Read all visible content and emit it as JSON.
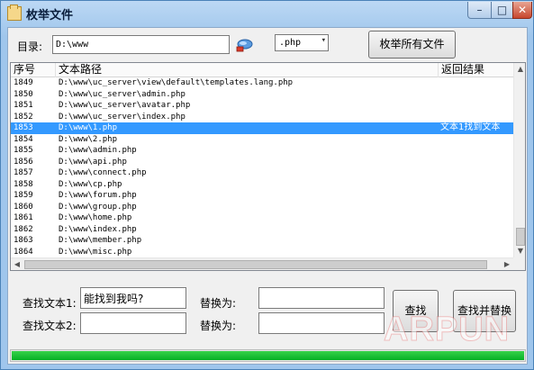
{
  "window": {
    "title": "枚举文件",
    "minimize_glyph": "–",
    "maximize_glyph": "□",
    "close_glyph": "✕",
    "icon": "folder-icon"
  },
  "toolbar": {
    "dir_label": "目录:",
    "dir_value": "D:\\www",
    "browse_icon": "browse-folder-icon",
    "ext_value": ".php",
    "enum_button": "枚举所有文件"
  },
  "list": {
    "columns": [
      "序号",
      "文本路径",
      "返回结果"
    ],
    "rows": [
      {
        "no": "1849",
        "path": "D:\\www\\uc_server\\view\\default\\templates.lang.php",
        "result": ""
      },
      {
        "no": "1850",
        "path": "D:\\www\\uc_server\\admin.php",
        "result": ""
      },
      {
        "no": "1851",
        "path": "D:\\www\\uc_server\\avatar.php",
        "result": ""
      },
      {
        "no": "1852",
        "path": "D:\\www\\uc_server\\index.php",
        "result": ""
      },
      {
        "no": "1853",
        "path": "D:\\www\\1.php",
        "result": "文本1找到文本"
      },
      {
        "no": "1854",
        "path": "D:\\www\\2.php",
        "result": ""
      },
      {
        "no": "1855",
        "path": "D:\\www\\admin.php",
        "result": ""
      },
      {
        "no": "1856",
        "path": "D:\\www\\api.php",
        "result": ""
      },
      {
        "no": "1857",
        "path": "D:\\www\\connect.php",
        "result": ""
      },
      {
        "no": "1858",
        "path": "D:\\www\\cp.php",
        "result": ""
      },
      {
        "no": "1859",
        "path": "D:\\www\\forum.php",
        "result": ""
      },
      {
        "no": "1860",
        "path": "D:\\www\\group.php",
        "result": ""
      },
      {
        "no": "1861",
        "path": "D:\\www\\home.php",
        "result": ""
      },
      {
        "no": "1862",
        "path": "D:\\www\\index.php",
        "result": ""
      },
      {
        "no": "1863",
        "path": "D:\\www\\member.php",
        "result": ""
      },
      {
        "no": "1864",
        "path": "D:\\www\\misc.php",
        "result": ""
      }
    ],
    "selected_index": 4
  },
  "search": {
    "find1_label": "查找文本1:",
    "find1_value": "能找到我吗?",
    "find2_label": "查找文本2:",
    "find2_value": "",
    "replace_label_1": "替换为:",
    "replace_value_1": "",
    "replace_label_2": "替换为:",
    "replace_value_2": "",
    "find_button": "查找",
    "replace_button": "查找并替换"
  },
  "watermark": "ARPUN",
  "progress": {
    "fraction": 1.0
  },
  "colors": {
    "selection": "#3399ff",
    "progress": "#06b025"
  }
}
